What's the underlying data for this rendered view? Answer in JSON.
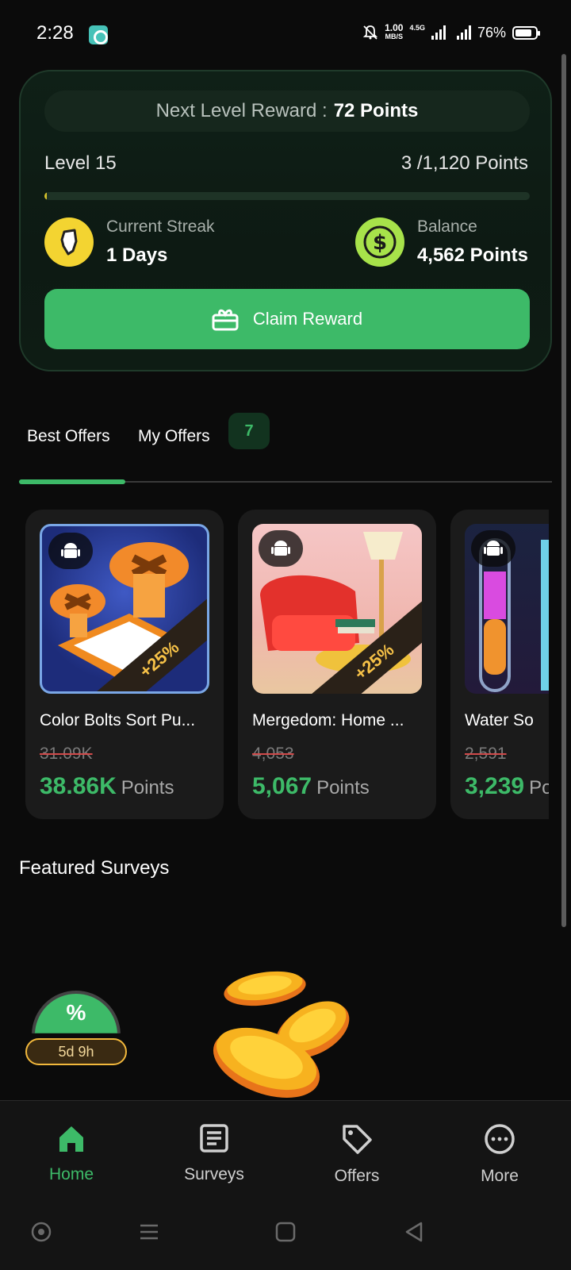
{
  "status": {
    "time": "2:28",
    "net_speed_value": "1.00",
    "net_speed_unit": "MB/S",
    "net_type": "4.5G",
    "battery": "76%"
  },
  "reward": {
    "next_level_prefix": "Next Level Reward :",
    "next_level_value": "72 Points",
    "level_label": "Level 15",
    "level_points": "3 /1,120 Points",
    "progress_fraction": 0.003,
    "streak_label": "Current Streak",
    "streak_value": "1 Days",
    "balance_label": "Balance",
    "balance_value": "4,562 Points",
    "claim_label": "Claim Reward"
  },
  "tabs": {
    "best": "Best Offers",
    "my": "My Offers",
    "my_count": "7"
  },
  "offers": [
    {
      "title": "Color Bolts Sort Pu...",
      "old_points": "31.09K",
      "new_points": "38.86K",
      "unit": "Points",
      "bonus": "+25%"
    },
    {
      "title": "Mergedom: Home ...",
      "old_points": "4,053",
      "new_points": "5,067",
      "unit": "Points",
      "bonus": "+25%"
    },
    {
      "title": "Water So",
      "old_points": "2,591",
      "new_points": "3,239",
      "unit": "Points",
      "bonus": ""
    }
  ],
  "featured": {
    "title": "Featured Surveys"
  },
  "promo": {
    "symbol": "%",
    "timer": "5d 9h"
  },
  "nav": {
    "home": "Home",
    "surveys": "Surveys",
    "offers": "Offers",
    "more": "More"
  },
  "colors": {
    "accent": "#3dba68",
    "background": "#0b0b0b",
    "card": "#1b1b1b"
  }
}
